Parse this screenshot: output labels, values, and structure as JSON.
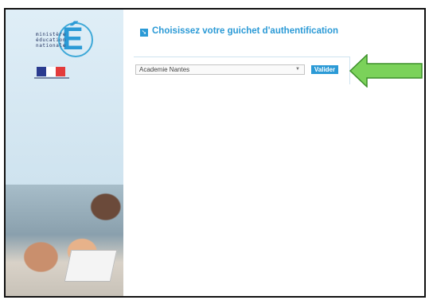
{
  "logo": {
    "line1": "ministère",
    "line2": "éducation",
    "line3": "nationale",
    "letter": "É"
  },
  "header": {
    "title": "Choisissez votre guichet d'authentification"
  },
  "form": {
    "select_value": "Academie Nantes",
    "submit_label": "Valider"
  },
  "colors": {
    "accent": "#2b9ad6",
    "annotation": "#7bd25a"
  }
}
